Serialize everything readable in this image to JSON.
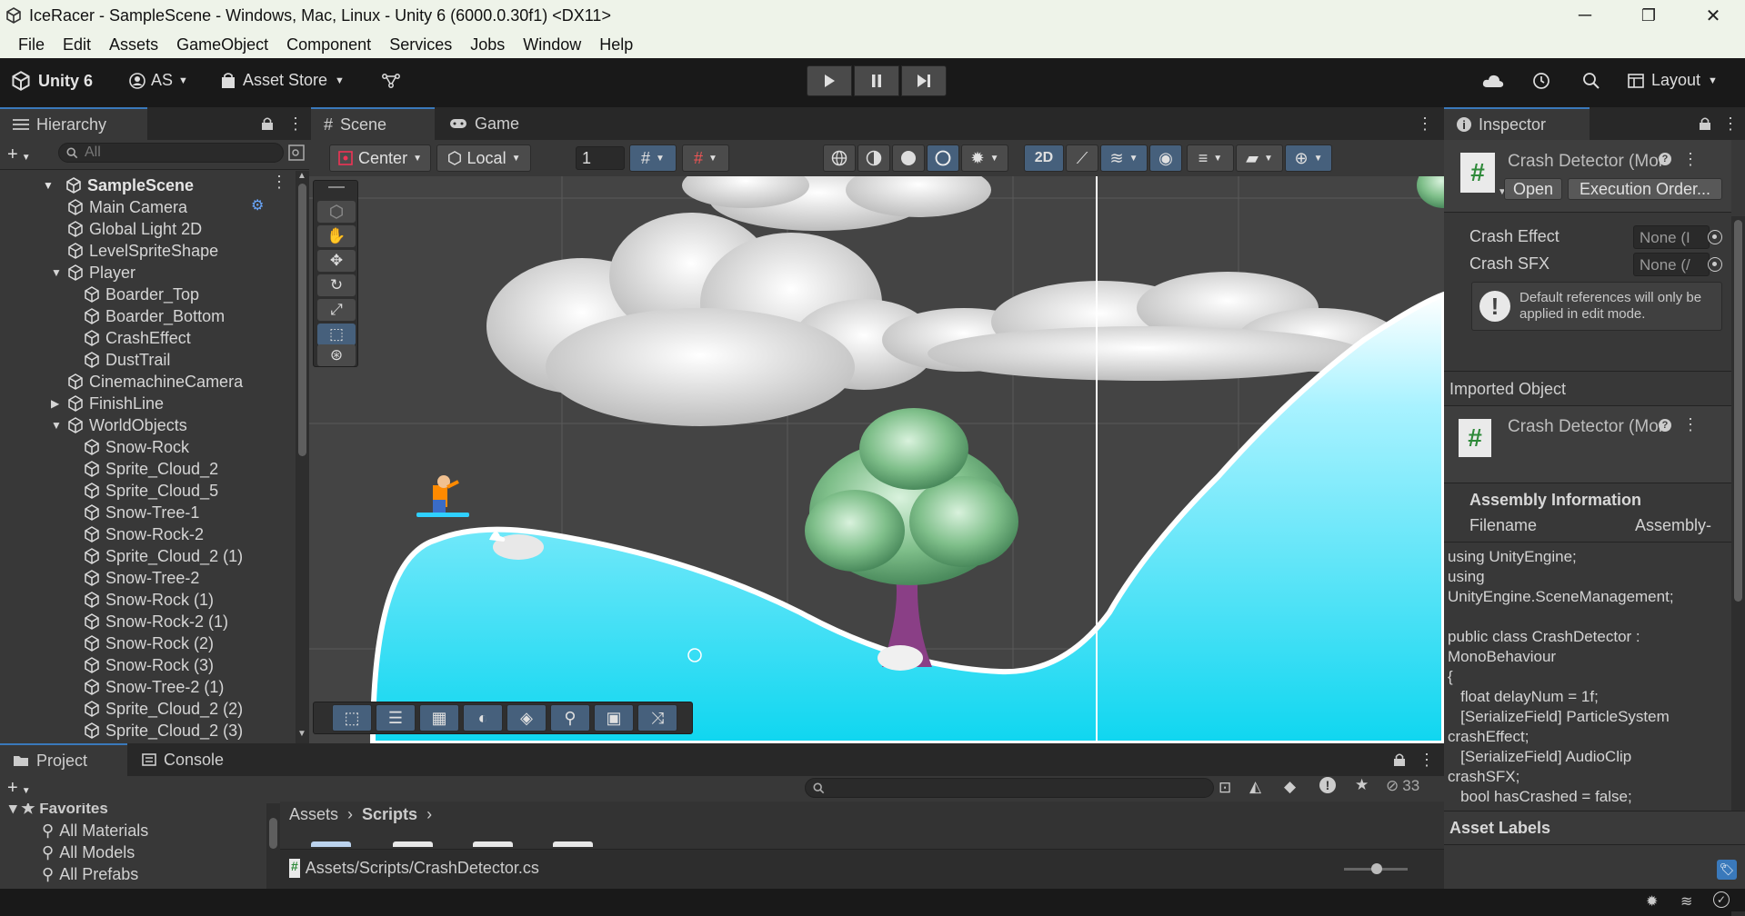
{
  "window": {
    "title": "IceRacer - SampleScene - Windows, Mac, Linux - Unity 6 (6000.0.30f1) <DX11>",
    "minimize": "─",
    "maximize": "❐",
    "close": "✕"
  },
  "menu": [
    "File",
    "Edit",
    "Assets",
    "GameObject",
    "Component",
    "Services",
    "Jobs",
    "Window",
    "Help"
  ],
  "toolbar": {
    "unity_label": "Unity 6",
    "account": "AS",
    "asset_store": "Asset Store",
    "layout": "Layout"
  },
  "hierarchy": {
    "tab": "Hierarchy",
    "search_placeholder": "All",
    "scene": "SampleScene",
    "items": [
      {
        "label": "Main Camera",
        "depth": 1
      },
      {
        "label": "Global Light 2D",
        "depth": 1
      },
      {
        "label": "LevelSpriteShape",
        "depth": 1
      },
      {
        "label": "Player",
        "depth": 1,
        "expanded": true
      },
      {
        "label": "Boarder_Top",
        "depth": 2
      },
      {
        "label": "Boarder_Bottom",
        "depth": 2
      },
      {
        "label": "CrashEffect",
        "depth": 2
      },
      {
        "label": "DustTrail",
        "depth": 2
      },
      {
        "label": "CinemachineCamera",
        "depth": 1
      },
      {
        "label": "FinishLine",
        "depth": 1,
        "collapsed": true
      },
      {
        "label": "WorldObjects",
        "depth": 1,
        "expanded": true
      },
      {
        "label": "Snow-Rock",
        "depth": 2
      },
      {
        "label": "Sprite_Cloud_2",
        "depth": 2
      },
      {
        "label": "Sprite_Cloud_5",
        "depth": 2
      },
      {
        "label": "Snow-Tree-1",
        "depth": 2
      },
      {
        "label": "Snow-Rock-2",
        "depth": 2
      },
      {
        "label": "Sprite_Cloud_2 (1)",
        "depth": 2
      },
      {
        "label": "Snow-Tree-2",
        "depth": 2
      },
      {
        "label": "Snow-Rock (1)",
        "depth": 2
      },
      {
        "label": "Snow-Rock-2 (1)",
        "depth": 2
      },
      {
        "label": "Snow-Rock (2)",
        "depth": 2
      },
      {
        "label": "Snow-Rock (3)",
        "depth": 2
      },
      {
        "label": "Snow-Tree-2 (1)",
        "depth": 2
      },
      {
        "label": "Sprite_Cloud_2 (2)",
        "depth": 2
      },
      {
        "label": "Sprite_Cloud_2 (3)",
        "depth": 2
      }
    ]
  },
  "scene_view": {
    "tabs": [
      "Scene",
      "Game"
    ],
    "pivot": "Center",
    "space": "Local",
    "grid_value": "1",
    "mode_2d": "2D"
  },
  "inspector": {
    "tab": "Inspector",
    "component": "Crash Detector (Mor",
    "open": "Open",
    "execution_order": "Execution Order...",
    "fields": [
      {
        "label": "Crash Effect",
        "value": "None (I"
      },
      {
        "label": "Crash SFX",
        "value": "None (/"
      }
    ],
    "info": "Default references will only be applied in edit mode.",
    "imported_header": "Imported Object",
    "imported_name": "Crash Detector (Mor",
    "assembly_header": "Assembly Information",
    "filename_label": "Filename",
    "filename_value": "Assembly-",
    "code": "using UnityEngine;\nusing\nUnityEngine.SceneManagement;\n\npublic class CrashDetector :\nMonoBehaviour\n{\n   float delayNum = 1f;\n   [SerializeField] ParticleSystem\ncrashEffect;\n   [SerializeField] AudioClip\ncrashSFX;\n   bool hasCrashed = false;",
    "asset_labels": "Asset Labels"
  },
  "project": {
    "tabs": [
      "Project",
      "Console"
    ],
    "favorites": "Favorites",
    "fav_items": [
      "All Materials",
      "All Models",
      "All Prefabs"
    ],
    "breadcrumb": [
      "Assets",
      "Scripts"
    ],
    "path": "Assets/Scripts/CrashDetector.cs",
    "hidden_count": "33"
  },
  "colors": {
    "accent": "#3a79bb",
    "sky": "#444444",
    "snow": "#0fd6f0"
  }
}
